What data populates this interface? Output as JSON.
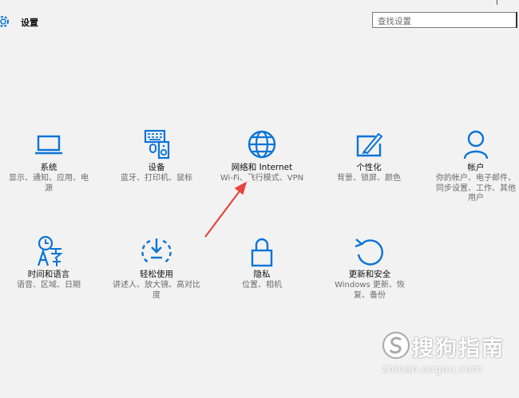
{
  "window": {
    "title": "设置"
  },
  "search": {
    "placeholder": "查找设置"
  },
  "tiles": [
    {
      "title": "系统",
      "desc": "显示、通知、应用、电源",
      "icon": "laptop-icon"
    },
    {
      "title": "设备",
      "desc": "蓝牙、打印机、鼠标",
      "icon": "devices-icon"
    },
    {
      "title": "网络和 Internet",
      "desc": "Wi-Fi、飞行模式、VPN",
      "icon": "globe-icon"
    },
    {
      "title": "个性化",
      "desc": "背景、锁屏、颜色",
      "icon": "personalization-icon"
    },
    {
      "title": "帐户",
      "desc": "你的帐户、电子邮件、同步设置、工作、其他用户",
      "icon": "person-icon"
    },
    {
      "title": "时间和语言",
      "desc": "语音、区域、日期",
      "icon": "time-language-icon"
    },
    {
      "title": "轻松使用",
      "desc": "讲述人、放大镜、高对比度",
      "icon": "ease-of-access-icon"
    },
    {
      "title": "隐私",
      "desc": "位置、相机",
      "icon": "lock-icon"
    },
    {
      "title": "更新和安全",
      "desc": "Windows 更新、恢复、备份",
      "icon": "update-icon"
    }
  ],
  "colors": {
    "accent": "#0a74d6",
    "annotation_arrow": "#e8453c"
  },
  "watermark": {
    "name": "搜狗指南",
    "url": "zhinan.sogou.com"
  }
}
